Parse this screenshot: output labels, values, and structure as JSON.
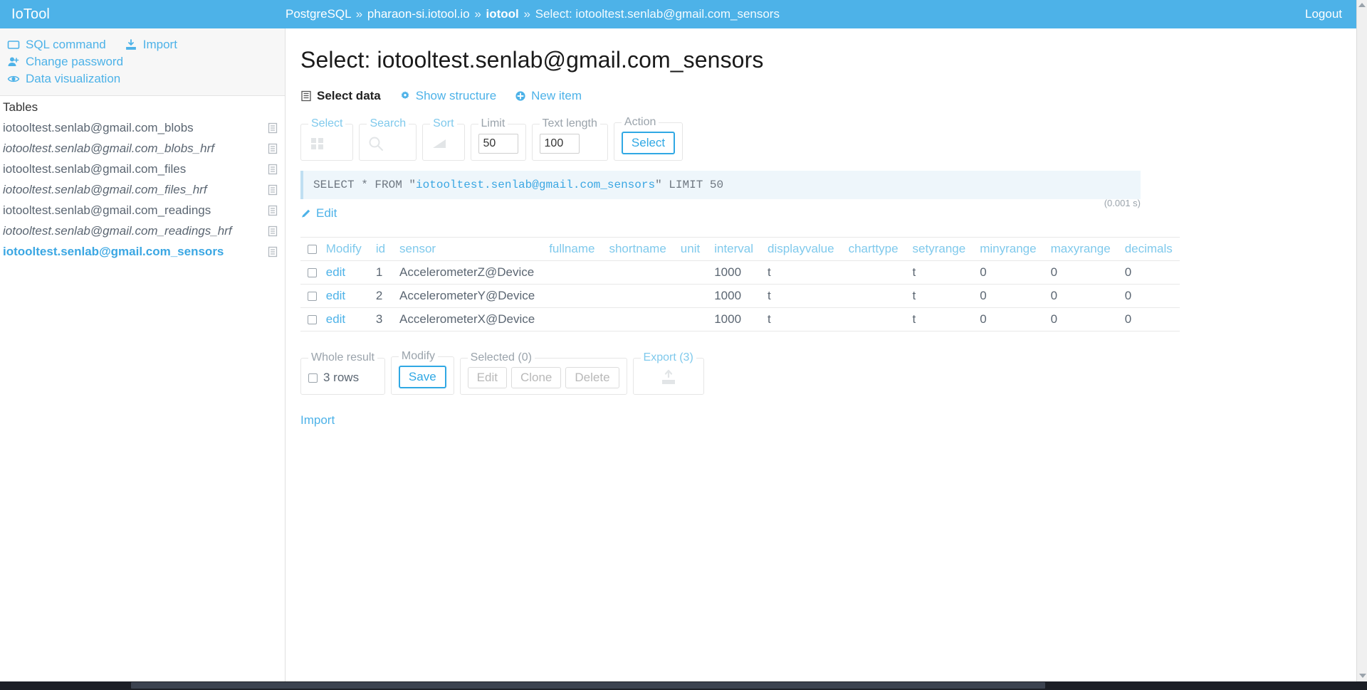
{
  "header": {
    "brand": "IoTool",
    "breadcrumb": {
      "engine": "PostgreSQL",
      "server": "pharaon-si.iotool.io",
      "database": "iotool",
      "current": "Select: iotooltest.senlab@gmail.com_sensors",
      "separator": "»"
    },
    "logout_label": "Logout",
    "accent_color": "#4db2e8"
  },
  "sidebar": {
    "nav": [
      {
        "label": "SQL command",
        "icon": "sql-command-icon"
      },
      {
        "label": "Import",
        "icon": "import-icon"
      },
      {
        "label": "Change password",
        "icon": "change-password-icon"
      },
      {
        "label": "Data visualization",
        "icon": "data-visualization-icon"
      }
    ],
    "tables_heading": "Tables",
    "tables": [
      {
        "name": "iotooltest.senlab@gmail.com_blobs",
        "is_view": false,
        "active": false
      },
      {
        "name": "iotooltest.senlab@gmail.com_blobs_hrf",
        "is_view": true,
        "active": false
      },
      {
        "name": "iotooltest.senlab@gmail.com_files",
        "is_view": false,
        "active": false
      },
      {
        "name": "iotooltest.senlab@gmail.com_files_hrf",
        "is_view": true,
        "active": false
      },
      {
        "name": "iotooltest.senlab@gmail.com_readings",
        "is_view": false,
        "active": false
      },
      {
        "name": "iotooltest.senlab@gmail.com_readings_hrf",
        "is_view": true,
        "active": false
      },
      {
        "name": "iotooltest.senlab@gmail.com_sensors",
        "is_view": false,
        "active": true
      }
    ]
  },
  "main": {
    "page_title": "Select: iotooltest.senlab@gmail.com_sensors",
    "tabs": [
      {
        "label": "Select data",
        "icon": "table-icon",
        "active": true
      },
      {
        "label": "Show structure",
        "icon": "gear-icon",
        "active": false
      },
      {
        "label": "New item",
        "icon": "plus-circle-icon",
        "active": false
      }
    ],
    "toolbar": [
      {
        "legend": "Select",
        "legend_is_link": true,
        "control": "icon",
        "icon": "columns-icon"
      },
      {
        "legend": "Search",
        "legend_is_link": true,
        "control": "icon",
        "icon": "search-icon"
      },
      {
        "legend": "Sort",
        "legend_is_link": true,
        "control": "icon",
        "icon": "sort-icon"
      },
      {
        "legend": "Limit",
        "legend_is_link": false,
        "control": "input",
        "value": "50"
      },
      {
        "legend": "Text length",
        "legend_is_link": false,
        "control": "input",
        "value": "100"
      },
      {
        "legend": "Action",
        "legend_is_link": false,
        "control": "button",
        "button_label": "Select"
      }
    ],
    "query": {
      "prefix": "SELECT * FROM \"",
      "identifier": "iotooltest.senlab@gmail.com_sensors",
      "suffix": "\" LIMIT 50",
      "duration": "(0.001 s)",
      "edit_label": "Edit"
    },
    "table": {
      "columns": [
        "Modify",
        "id",
        "sensor",
        "fullname",
        "shortname",
        "unit",
        "interval",
        "displayvalue",
        "charttype",
        "setyrange",
        "minyrange",
        "maxyrange",
        "decimals"
      ],
      "edit_label": "edit",
      "rows": [
        {
          "id": "1",
          "sensor": "AccelerometerZ@Device",
          "fullname": "",
          "shortname": "",
          "unit": "",
          "interval": "1000",
          "displayvalue": "t",
          "charttype": "",
          "setyrange": "t",
          "minyrange": "0",
          "maxyrange": "0",
          "decimals": "0"
        },
        {
          "id": "2",
          "sensor": "AccelerometerY@Device",
          "fullname": "",
          "shortname": "",
          "unit": "",
          "interval": "1000",
          "displayvalue": "t",
          "charttype": "",
          "setyrange": "t",
          "minyrange": "0",
          "maxyrange": "0",
          "decimals": "0"
        },
        {
          "id": "3",
          "sensor": "AccelerometerX@Device",
          "fullname": "",
          "shortname": "",
          "unit": "",
          "interval": "1000",
          "displayvalue": "t",
          "charttype": "",
          "setyrange": "t",
          "minyrange": "0",
          "maxyrange": "0",
          "decimals": "0"
        }
      ]
    },
    "bottom": {
      "whole_result_legend": "Whole result",
      "rows_label": "3 rows",
      "modify_legend": "Modify",
      "save_label": "Save",
      "selected_legend": "Selected (0)",
      "selected_buttons": [
        "Edit",
        "Clone",
        "Delete"
      ],
      "export_legend": "Export (3)",
      "export_icon": "export-upload-icon"
    },
    "import_link": "Import"
  }
}
